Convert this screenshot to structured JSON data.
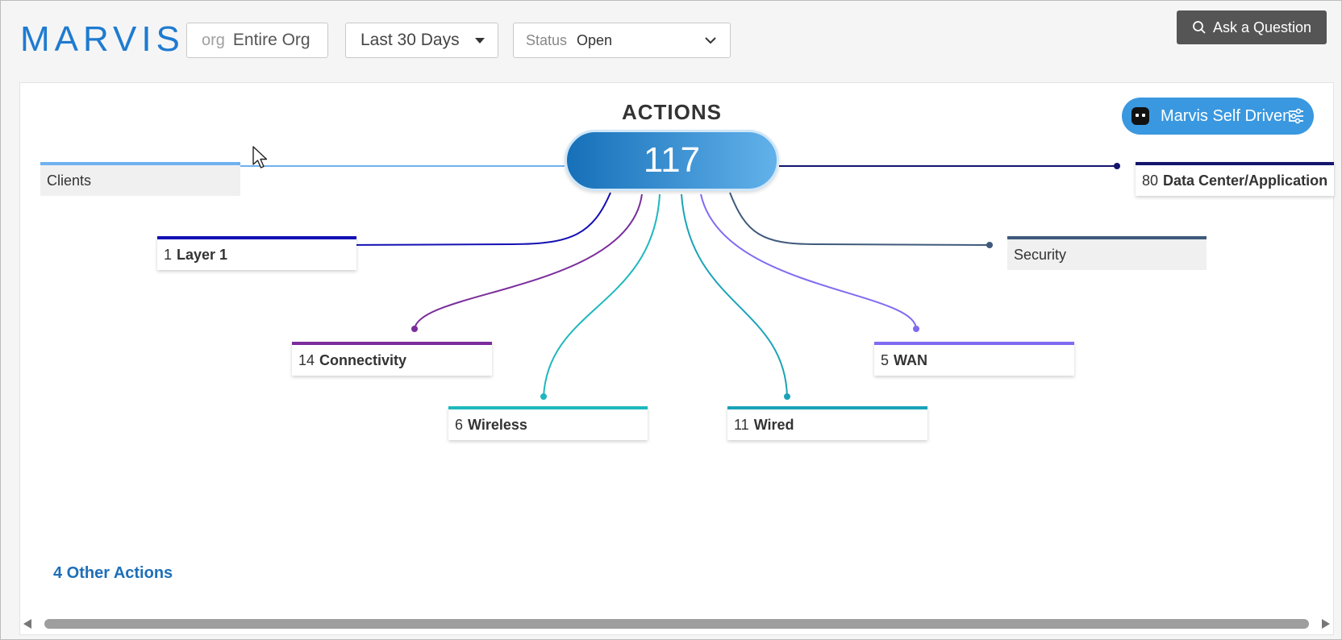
{
  "brand": "MARVIS",
  "filters": {
    "org": {
      "prefix": "org",
      "value": "Entire Org"
    },
    "date_range": "Last 30 Days",
    "status": {
      "label": "Status",
      "value": "Open"
    }
  },
  "ask_button": "Ask a Question",
  "actions": {
    "title": "ACTIONS",
    "total": "117",
    "self_driven_label": "Marvis Self Driven",
    "categories": [
      {
        "name": "Clients",
        "count": "",
        "color": "#6eb1f0",
        "muted": true
      },
      {
        "name": "Layer 1",
        "count": "1",
        "color": "#1410b4"
      },
      {
        "name": "Connectivity",
        "count": "14",
        "color": "#7b2d9c"
      },
      {
        "name": "Wireless",
        "count": "6",
        "color": "#1eb8bd"
      },
      {
        "name": "Wired",
        "count": "11",
        "color": "#1aa3b8"
      },
      {
        "name": "WAN",
        "count": "5",
        "color": "#7f6cf2"
      },
      {
        "name": "Security",
        "count": "",
        "color": "#3f5a7c",
        "muted": true
      },
      {
        "name": "Data Center/Application",
        "count": "80",
        "color": "#14146e"
      }
    ],
    "other_actions": "4 Other Actions"
  },
  "icons": {
    "search": "search-icon",
    "dropdown": "caret-down-icon",
    "chevron": "chevron-down-icon",
    "robot": "robot-icon",
    "tune": "sliders-icon",
    "cursor": "mouse-cursor-icon"
  }
}
